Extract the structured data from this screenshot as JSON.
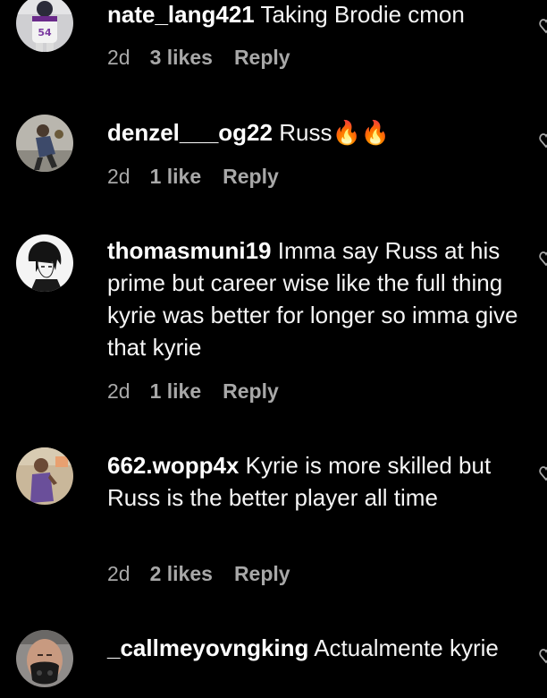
{
  "colors": {
    "background": "#000000",
    "text": "#f5f5f5",
    "secondary": "#a8a8a8"
  },
  "comments": [
    {
      "username": "nate_lang421",
      "text": "Taking Brodie cmon",
      "age": "2d",
      "likes": "3 likes",
      "reply": "Reply",
      "avatar_icon": "football-player-avatar",
      "like_icon": "heart-icon"
    },
    {
      "username": "denzel___og22",
      "text": "Russ🔥🔥",
      "age": "2d",
      "likes": "1 like",
      "reply": "Reply",
      "avatar_icon": "basketball-player-avatar",
      "like_icon": "heart-icon"
    },
    {
      "username": "thomasmuni19",
      "text": "Imma say Russ at his prime but career wise like the full thing kyrie was better for longer so imma give that kyrie",
      "age": "2d",
      "likes": "1 like",
      "reply": "Reply",
      "avatar_icon": "anime-character-avatar",
      "like_icon": "heart-icon"
    },
    {
      "username": "662.wopp4x",
      "text": "Kyrie is more skilled but Russ is the better player all time",
      "age": "2d",
      "likes": "2 likes",
      "reply": "Reply",
      "avatar_icon": "person-photo-avatar",
      "like_icon": "heart-icon"
    },
    {
      "username": "_callmeyovngking",
      "text": "Actualmente kyrie",
      "avatar_icon": "masked-person-avatar",
      "like_icon": "heart-icon"
    }
  ]
}
